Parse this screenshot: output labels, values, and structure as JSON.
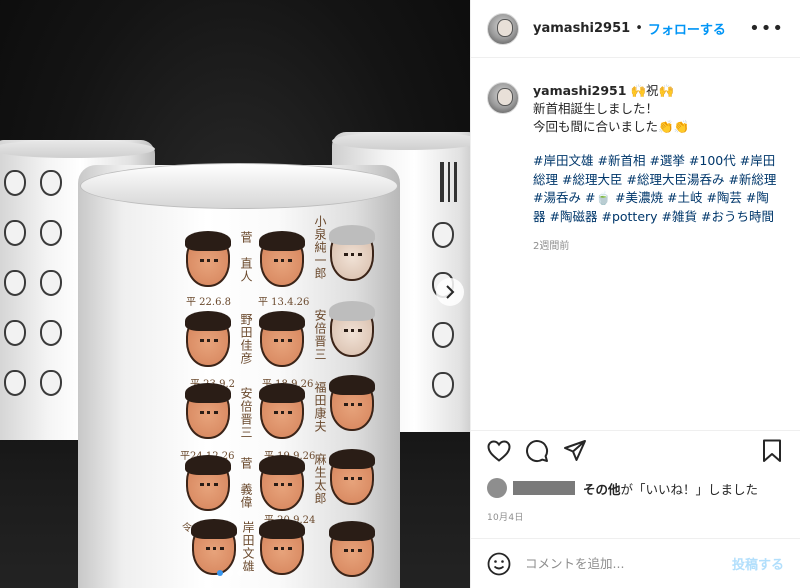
{
  "header": {
    "username": "yamashi2951",
    "separator": "•",
    "follow_label": "フォローする",
    "more_label": "•••"
  },
  "caption": {
    "username": "yamashi2951",
    "first_line": "🙌祝🙌",
    "line2": "新首相誕生しました！",
    "line3": "今回も間に合いました👏👏",
    "tags": [
      "#岸田文雄",
      "#新首相",
      "#選挙",
      "#100代",
      "#岸田総理",
      "#総理大臣",
      "#総理大臣湯呑み",
      "#新総理",
      "#湯呑み",
      "#🍵",
      "#美濃焼",
      "#土岐",
      "#陶芸",
      "#陶器",
      "#陶磁器",
      "#pottery",
      "#雑貨",
      "#おうち時間"
    ],
    "time_ago": "2週間前"
  },
  "likes": {
    "text_bold": "その他",
    "text_rest": "が「いいね！」しました"
  },
  "post_date": "10月4日",
  "comment": {
    "placeholder": "コメントを追加...",
    "post_label": "投稿する"
  },
  "photo": {
    "cup_text": {
      "col1_name": "菅　直人",
      "col1_date": "平 22.6.8",
      "col2_name": "小泉純一郎",
      "col2_date": "平 13.4.26",
      "col3_name": "野田佳彦",
      "col3_date": "平 23.9.2",
      "col4_name": "安倍晋三",
      "col4_date": "平 18.9.26",
      "col5_name": "安倍晋三",
      "col5_date": "平24.12.26",
      "col6_name": "福田康夫",
      "col6_date": "平 19.9.26",
      "col7_name": "菅　義偉",
      "col7_date": "令 2.9.16",
      "col8_name": "麻生太郎",
      "col8_date": "平 20.9.24",
      "col9_name": "岸田文雄"
    },
    "carousel_icon": "chevron-right-icon",
    "slide_count": 4,
    "active_slide": 1
  },
  "colors": {
    "link": "#00376b",
    "follow": "#0095f6",
    "post_disabled": "#b2dffc",
    "carousel_active": "#3897f0"
  }
}
